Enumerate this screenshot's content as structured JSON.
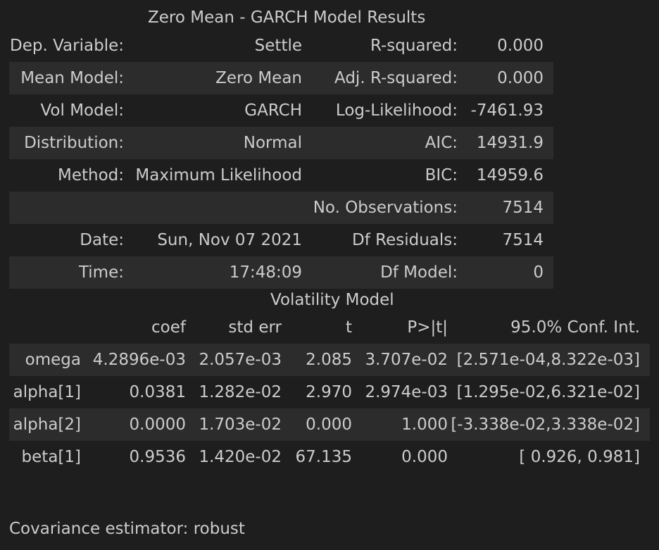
{
  "title": "Zero Mean - GARCH Model Results",
  "summary_rows": [
    [
      "Dep. Variable:",
      "Settle",
      "R-squared:",
      "0.000"
    ],
    [
      "Mean Model:",
      "Zero Mean",
      "Adj. R-squared:",
      "0.000"
    ],
    [
      "Vol Model:",
      "GARCH",
      "Log-Likelihood:",
      "-7461.93"
    ],
    [
      "Distribution:",
      "Normal",
      "AIC:",
      "14931.9"
    ],
    [
      "Method:",
      "Maximum Likelihood",
      "BIC:",
      "14959.6"
    ],
    [
      "",
      "",
      "No. Observations:",
      "7514"
    ],
    [
      "Date:",
      "Sun, Nov 07 2021",
      "Df Residuals:",
      "7514"
    ],
    [
      "Time:",
      "17:48:09",
      "Df Model:",
      "0"
    ]
  ],
  "volatility_title": "Volatility Model",
  "volatility_headers": [
    "",
    "coef",
    "std err",
    "t",
    "P>|t|",
    "95.0% Conf. Int."
  ],
  "volatility_rows": [
    [
      "omega",
      "4.2896e-03",
      "2.057e-03",
      "2.085",
      "3.707e-02",
      "[2.571e-04,8.322e-03]"
    ],
    [
      "alpha[1]",
      "0.0381",
      "1.282e-02",
      "2.970",
      "2.974e-03",
      "[1.295e-02,6.321e-02]"
    ],
    [
      "alpha[2]",
      "0.0000",
      "1.703e-02",
      "0.000",
      "1.000",
      "[-3.338e-02,3.338e-02]"
    ],
    [
      "beta[1]",
      "0.9536",
      "1.420e-02",
      "67.135",
      "0.000",
      "[ 0.926, 0.981]"
    ]
  ],
  "footer": "Covariance estimator: robust"
}
